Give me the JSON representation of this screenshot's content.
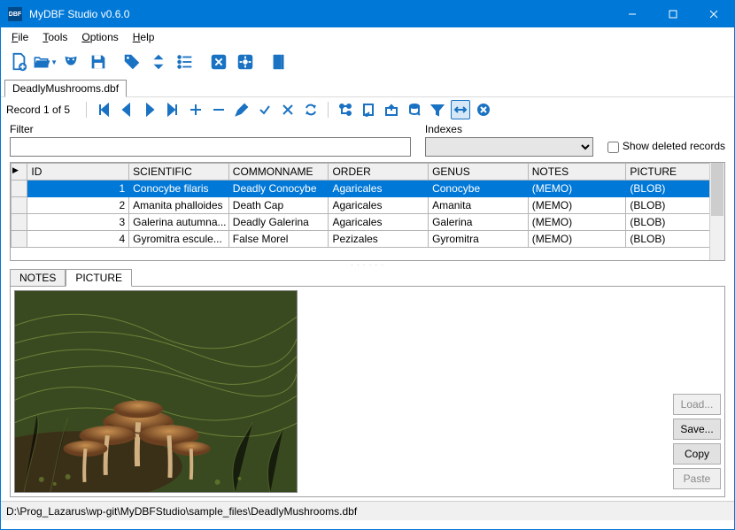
{
  "window": {
    "title": "MyDBF Studio v0.6.0"
  },
  "menu": {
    "file": "File",
    "tools": "Tools",
    "options": "Options",
    "help": "Help"
  },
  "filetab": {
    "name": "DeadlyMushrooms.dbf"
  },
  "record_status": "Record 1 of 5",
  "filter": {
    "label": "Filter",
    "value": ""
  },
  "indexes": {
    "label": "Indexes",
    "value": ""
  },
  "show_deleted": {
    "label": "Show deleted records",
    "checked": false
  },
  "columns": [
    "ID",
    "SCIENTIFIC",
    "COMMONNAME",
    "ORDER",
    "GENUS",
    "NOTES",
    "PICTURE"
  ],
  "rows": [
    {
      "id": "1",
      "scientific": "Conocybe filaris",
      "common": "Deadly Conocybe",
      "order": "Agaricales",
      "genus": "Conocybe",
      "notes": "(MEMO)",
      "picture": "(BLOB)",
      "selected": true
    },
    {
      "id": "2",
      "scientific": "Amanita phalloides",
      "common": "Death Cap",
      "order": "Agaricales",
      "genus": "Amanita",
      "notes": "(MEMO)",
      "picture": "(BLOB)"
    },
    {
      "id": "3",
      "scientific": "Galerina autumna...",
      "common": "Deadly Galerina",
      "order": "Agaricales",
      "genus": "Galerina",
      "notes": "(MEMO)",
      "picture": "(BLOB)"
    },
    {
      "id": "4",
      "scientific": "Gyromitra escule...",
      "common": "False Morel",
      "order": "Pezizales",
      "genus": "Gyromitra",
      "notes": "(MEMO)",
      "picture": "(BLOB)"
    }
  ],
  "detail_tabs": {
    "notes": "NOTES",
    "picture": "PICTURE"
  },
  "buttons": {
    "load": "Load...",
    "save": "Save...",
    "copy": "Copy",
    "paste": "Paste"
  },
  "statusbar": "D:\\Prog_Lazarus\\wp-git\\MyDBFStudio\\sample_files\\DeadlyMushrooms.dbf"
}
